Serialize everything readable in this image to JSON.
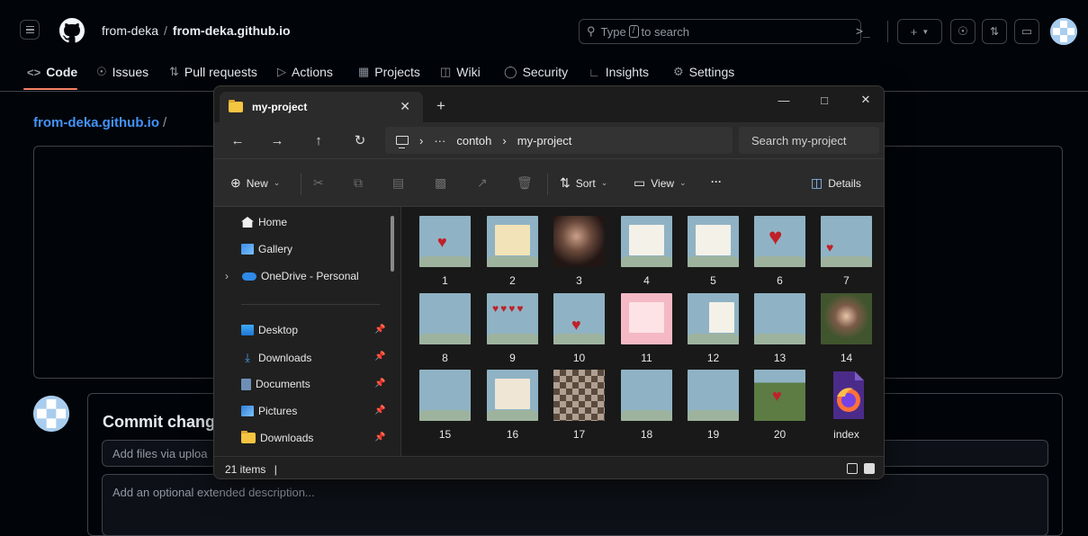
{
  "github": {
    "owner": "from-deka",
    "repo": "from-deka.github.io",
    "search_prefix": "Type",
    "search_key": "/",
    "search_suffix": "to search",
    "nav": [
      "Code",
      "Issues",
      "Pull requests",
      "Actions",
      "Projects",
      "Wiki",
      "Security",
      "Insights",
      "Settings"
    ],
    "breadcrumb_repo": "from-deka.github.io",
    "breadcrumb_sep": "/",
    "commit_title": "Commit chang",
    "commit_input_placeholder": "Add files via uploa",
    "commit_desc_placeholder": "Add an optional extended description..."
  },
  "explorer": {
    "tab_title": "my-project",
    "path_ellipsis": "···",
    "path": [
      "contoh",
      "my-project"
    ],
    "search_placeholder": "Search my-project",
    "toolbar": {
      "new": "New",
      "sort": "Sort",
      "view": "View",
      "more": "···",
      "details": "Details"
    },
    "nav_pane": [
      "Home",
      "Gallery",
      "OneDrive - Personal",
      "Desktop",
      "Downloads",
      "Documents",
      "Pictures",
      "Downloads"
    ],
    "files": [
      "1",
      "2",
      "3",
      "4",
      "5",
      "6",
      "7",
      "8",
      "9",
      "10",
      "11",
      "12",
      "13",
      "14",
      "15",
      "16",
      "17",
      "18",
      "19",
      "20",
      "index"
    ],
    "status_count": "21 items",
    "status_cursor": "|"
  },
  "colors": {
    "github_bg": "#010409",
    "github_link": "#4493f8",
    "explorer_bg": "#191919",
    "thumb_blue": "#8fb3c4",
    "folder": "#f5c542"
  }
}
